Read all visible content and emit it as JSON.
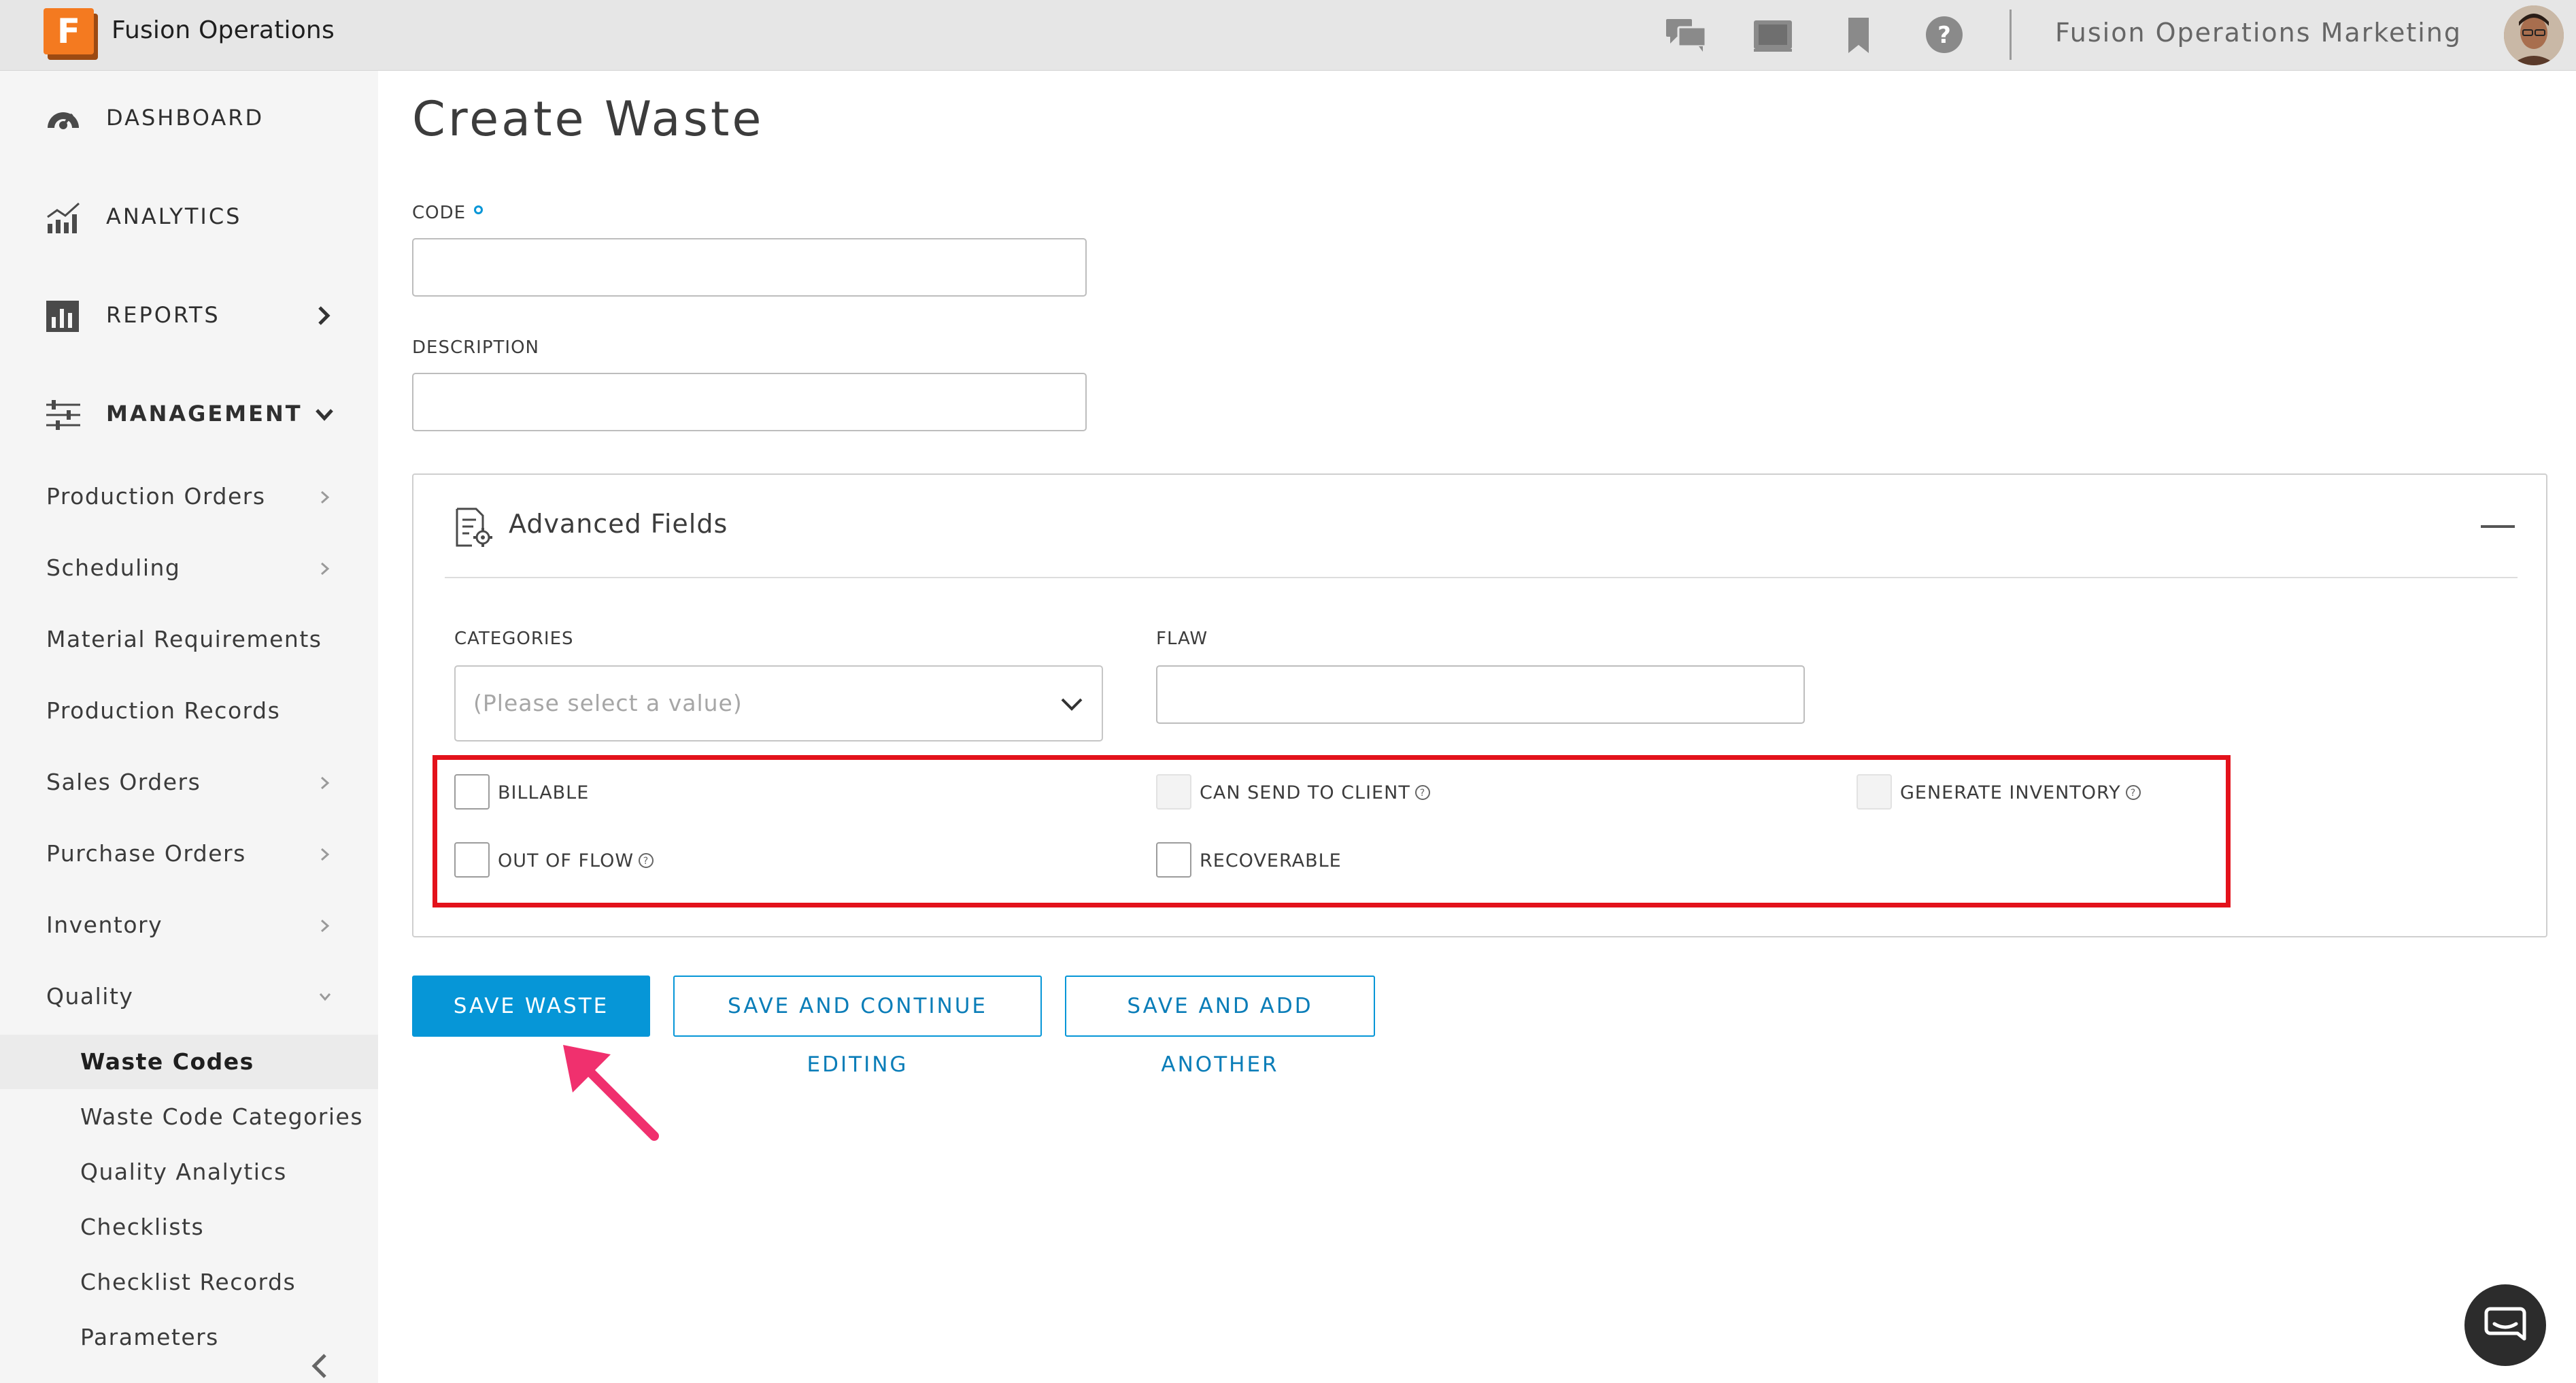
{
  "header": {
    "logo_letter": "F",
    "app_name": "Fusion Operations",
    "icons": [
      "chat-icon",
      "screen-icon",
      "bookmark-icon",
      "help-icon"
    ],
    "org_name": "Fusion Operations Marketing"
  },
  "sidebar": {
    "main_items": [
      {
        "label": "DASHBOARD",
        "icon": "gauge-icon"
      },
      {
        "label": "ANALYTICS",
        "icon": "chart-icon"
      },
      {
        "label": "REPORTS",
        "icon": "bar-chart-icon"
      },
      {
        "label": "MANAGEMENT",
        "icon": "sliders-icon"
      }
    ],
    "management_items": [
      {
        "label": "Production Orders"
      },
      {
        "label": "Scheduling"
      },
      {
        "label": "Material Requirements"
      },
      {
        "label": "Production Records"
      },
      {
        "label": "Sales Orders"
      },
      {
        "label": "Purchase Orders"
      },
      {
        "label": "Inventory"
      },
      {
        "label": "Quality"
      }
    ],
    "quality_items": [
      {
        "label": "Waste Codes",
        "active": true
      },
      {
        "label": "Waste Code Categories"
      },
      {
        "label": "Quality Analytics"
      },
      {
        "label": "Checklists"
      },
      {
        "label": "Checklist Records"
      },
      {
        "label": "Parameters"
      }
    ]
  },
  "form": {
    "title": "Create Waste",
    "code_label": "CODE",
    "code_value": "",
    "description_label": "DESCRIPTION",
    "description_value": "",
    "advanced": {
      "title": "Advanced Fields",
      "categories_label": "CATEGORIES",
      "categories_placeholder": "(Please select a value)",
      "flaw_label": "FLAW",
      "flaw_value": "",
      "checkboxes": [
        {
          "label": "BILLABLE",
          "checked": false,
          "disabled": false
        },
        {
          "label": "CAN SEND TO CLIENT",
          "checked": false,
          "disabled": true
        },
        {
          "label": "GENERATE INVENTORY",
          "checked": false,
          "disabled": true
        },
        {
          "label": "OUT OF FLOW",
          "checked": false,
          "disabled": false
        },
        {
          "label": "RECOVERABLE",
          "checked": false,
          "disabled": false
        }
      ]
    },
    "buttons": {
      "save": "SAVE WASTE",
      "save_continue": "SAVE AND CONTINUE EDITING",
      "save_add": "SAVE AND ADD ANOTHER"
    }
  },
  "colors": {
    "accent": "#0696d7",
    "highlight_box": "#e3121b",
    "annotation_arrow": "#f0306e",
    "logo": "#f47a20"
  }
}
